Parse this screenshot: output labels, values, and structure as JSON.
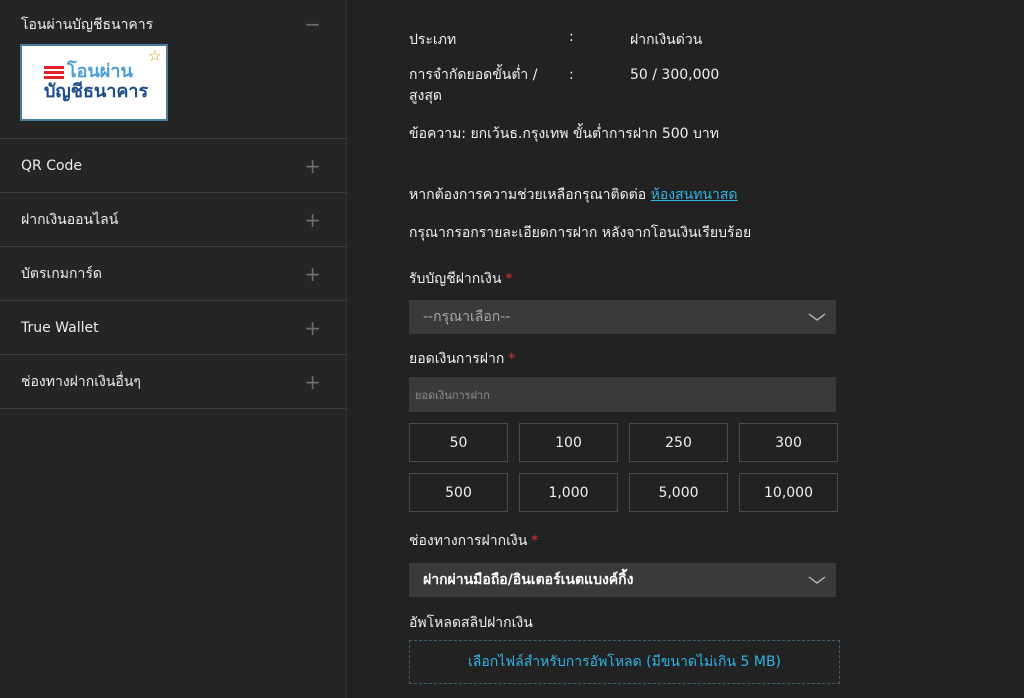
{
  "sidebar": {
    "items": [
      {
        "label": "โอนผ่านบัญชีธนาคาร",
        "toggle": "−"
      },
      {
        "label": "QR Code",
        "toggle": "+"
      },
      {
        "label": "ฝากเงินออนไลน์",
        "toggle": "+"
      },
      {
        "label": "บัตรเกมการ์ด",
        "toggle": "+"
      },
      {
        "label": "True Wallet",
        "toggle": "+"
      },
      {
        "label": "ช่องทางฝากเงินอื่นๆ",
        "toggle": "+"
      }
    ],
    "bank_logo": {
      "line1": "โอนผ่าน",
      "line2": "บัญชีธนาคาร",
      "star": "☆"
    }
  },
  "info": {
    "type_label": "ประเภท",
    "type_colon": ":",
    "type_value": "ฝากเงินด่วน",
    "limit_label_1": "การจำกัดยอดขั้นต่ำ /",
    "limit_label_2": "สูงสุด",
    "limit_colon": ":",
    "limit_value": "50 / 300,000",
    "message": "ข้อความ: ยกเว้นธ.กรุงเทพ ขั้นต่ำการฝาก 500 บาท"
  },
  "help": {
    "prefix": "หากต้องการความช่วยเหลือกรุณาติดต่อ ",
    "link": "ห้องสนทนาสด"
  },
  "instruction": "กรุณากรอกรายละเอียดการฝาก หลังจากโอนเงินเรียบร้อย",
  "form": {
    "account_label": "รับบัญชีฝากเงิน",
    "required_mark": "*",
    "account_select": "--กรุณาเลือก--",
    "amount_label": "ยอดเงินการฝาก",
    "amount_placeholder": "ยอดเงินการฝาก",
    "quick_amounts": [
      "50",
      "100",
      "250",
      "300",
      "500",
      "1,000",
      "5,000",
      "10,000"
    ],
    "channel_label": "ช่องทางการฝากเงิน",
    "channel_select": "ฝากผ่านมือถือ/อินเตอร์เนตแบงค์กิ้ง",
    "upload_label": "อัพโหลดสลิปฝากเงิน",
    "upload_button": "เลือกไฟล์สำหรับการอัพโหลด (มีขนาดไม่เกิน 5 MB)"
  },
  "colors": {
    "background": "#222222",
    "link": "#2fb3e6",
    "required": "#e0342e"
  }
}
